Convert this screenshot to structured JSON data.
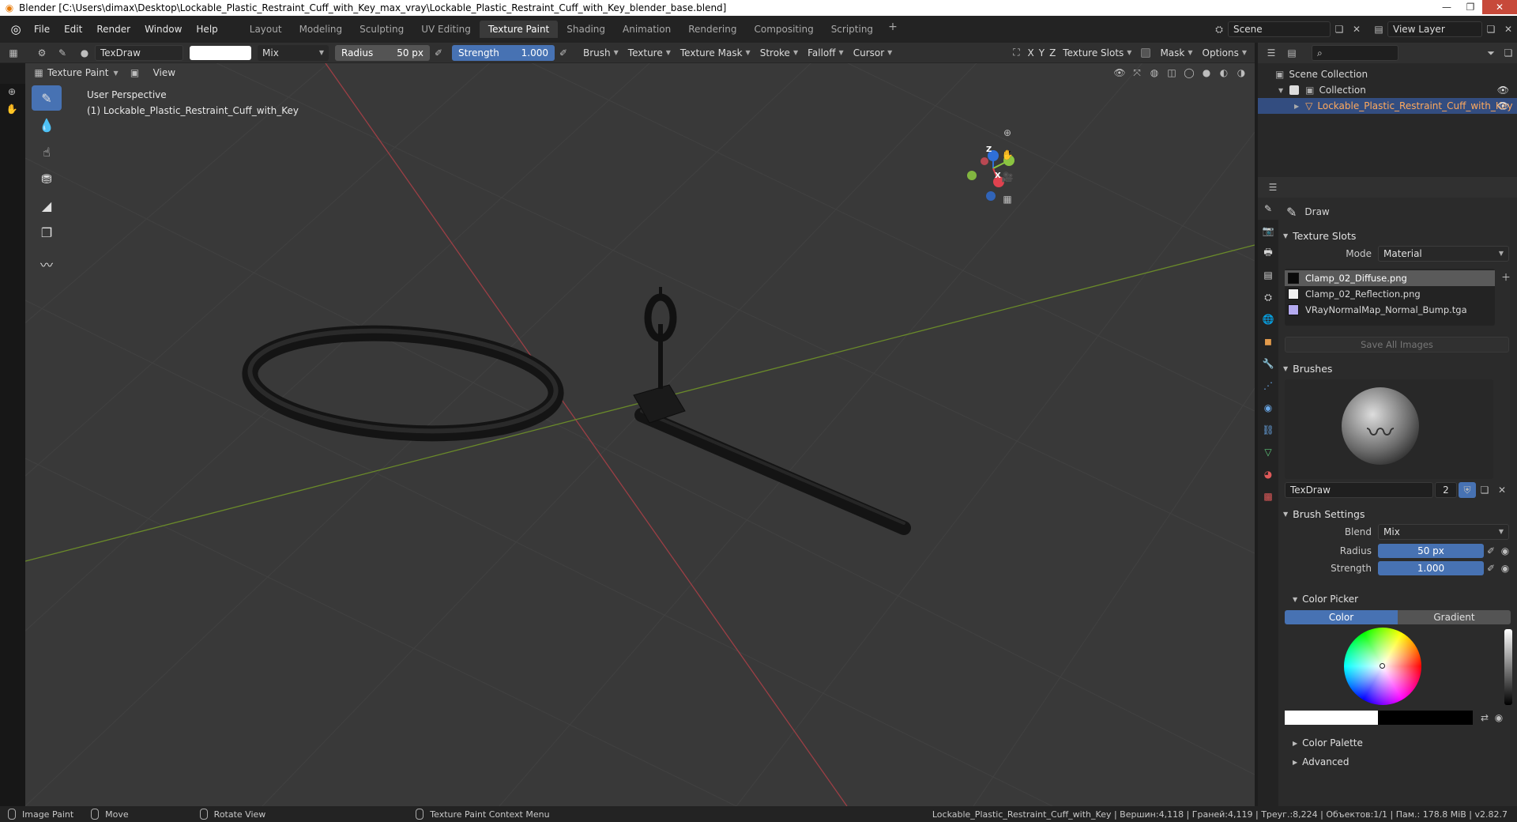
{
  "window": {
    "title": "Blender [C:\\Users\\dimax\\Desktop\\Lockable_Plastic_Restraint_Cuff_with_Key_max_vray\\Lockable_Plastic_Restraint_Cuff_with_Key_blender_base.blend]"
  },
  "menu": {
    "file": "File",
    "edit": "Edit",
    "render": "Render",
    "window": "Window",
    "help": "Help"
  },
  "workspaces": [
    "Layout",
    "Modeling",
    "Sculpting",
    "UV Editing",
    "Texture Paint",
    "Shading",
    "Animation",
    "Rendering",
    "Compositing",
    "Scripting"
  ],
  "workspace_add": "+",
  "scene": {
    "name": "Scene",
    "view_layer": "View Layer"
  },
  "toolheader": {
    "brush_name": "TexDraw",
    "blend": "Mix",
    "radius_label": "Radius",
    "radius_value": "50 px",
    "strength_label": "Strength",
    "strength_value": "1.000",
    "brush": "Brush",
    "texture": "Texture",
    "texture_mask": "Texture Mask",
    "stroke": "Stroke",
    "falloff": "Falloff",
    "cursor": "Cursor",
    "axis_x": "X",
    "axis_y": "Y",
    "axis_z": "Z",
    "texture_slots": "Texture Slots",
    "mask": "Mask",
    "options": "Options"
  },
  "vpheader": {
    "mode": "Texture Paint",
    "view": "View"
  },
  "viewport": {
    "perspective": "User Perspective",
    "object": "(1) Lockable_Plastic_Restraint_Cuff_with_Key",
    "gizmo": {
      "x": "X",
      "y": "Y",
      "z": "Z"
    }
  },
  "outliner": {
    "scene_collection": "Scene Collection",
    "collection": "Collection",
    "object": "Lockable_Plastic_Restraint_Cuff_with_Key"
  },
  "properties": {
    "tool_name": "Draw",
    "texture_slots": {
      "header": "Texture Slots",
      "mode_label": "Mode",
      "mode_value": "Material",
      "slots": [
        {
          "name": "Clamp_02_Diffuse.png",
          "color": "#0a0a0a"
        },
        {
          "name": "Clamp_02_Reflection.png",
          "color": "#f0f0f0"
        },
        {
          "name": "VRayNormalMap_Normal_Bump.tga",
          "color": "#b4aaf0"
        }
      ],
      "save_all": "Save All Images"
    },
    "brushes": {
      "header": "Brushes",
      "name": "TexDraw",
      "users": "2"
    },
    "brush_settings": {
      "header": "Brush Settings",
      "blend_label": "Blend",
      "blend_value": "Mix",
      "radius_label": "Radius",
      "radius_value": "50 px",
      "strength_label": "Strength",
      "strength_value": "1.000"
    },
    "color_picker": {
      "header": "Color Picker",
      "tab_color": "Color",
      "tab_gradient": "Gradient"
    },
    "color_palette": "Color Palette",
    "advanced": "Advanced"
  },
  "statusbar": {
    "image_paint": "Image Paint",
    "move": "Move",
    "rotate_view": "Rotate View",
    "context_menu": "Texture Paint Context Menu",
    "stats": "Lockable_Plastic_Restraint_Cuff_with_Key | Вершин:4,118 | Граней:4,119 | Треуг.:8,224 | Объектов:1/1 | Пам.: 178.8 MiB | v2.82.7"
  },
  "colors": {
    "accent": "#4772b3",
    "active_tab": "#3a3a3a",
    "selection": "#334d80",
    "object_text": "#ffa95c"
  }
}
